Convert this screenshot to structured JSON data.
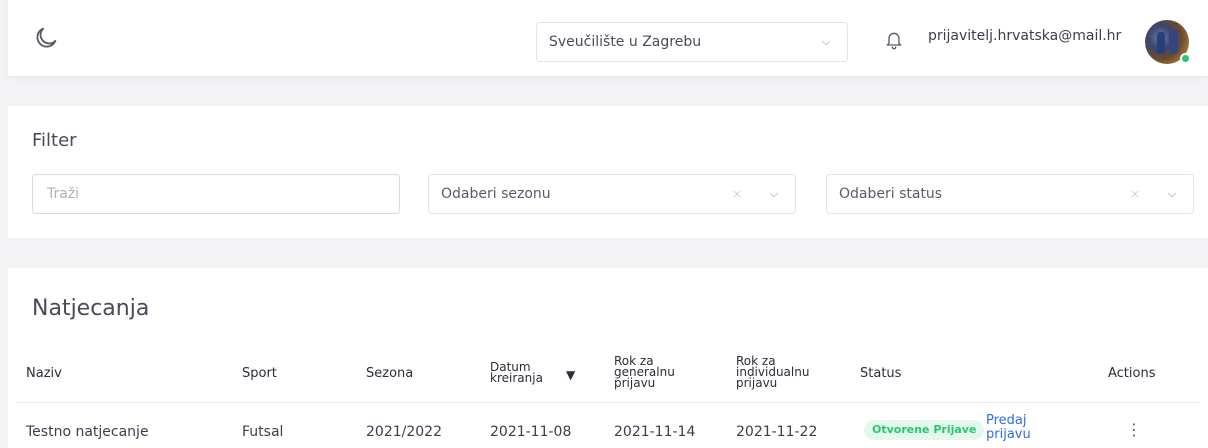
{
  "header": {
    "university_select": {
      "value": "Sveučilište u Zagrebu"
    },
    "user_email": "prijavitelj.hrvatska@mail.hr"
  },
  "filter": {
    "title": "Filter",
    "search_placeholder": "Traži",
    "season_placeholder": "Odaberi sezonu",
    "status_placeholder": "Odaberi status"
  },
  "competitions": {
    "title": "Natjecanja",
    "columns": {
      "name": "Naziv",
      "sport": "Sport",
      "season": "Sezona",
      "created": [
        "Datum",
        "kreiranja"
      ],
      "general_deadline": [
        "Rok za",
        "generalnu",
        "prijavu"
      ],
      "individual_deadline": [
        "Rok za",
        "individualnu",
        "prijavu"
      ],
      "status": "Status",
      "actions": "Actions"
    },
    "sort_indicator": "▼",
    "rows": [
      {
        "name": "Testno natjecanje",
        "sport": "Futsal",
        "season": "2021/2022",
        "created": "2021-11-08",
        "general_deadline": "2021-11-14",
        "individual_deadline": "2021-11-22",
        "status": "Otvorene Prijave",
        "action_link": [
          "Predaj",
          "prijavu"
        ],
        "actions_menu": "⋮"
      }
    ]
  },
  "colors": {
    "status_green": "#28c76f",
    "status_green_bg": "#e5f8ed",
    "link_blue": "#2e6be6",
    "page_bg": "#f3f3f5"
  },
  "icons": {
    "theme_toggle": "moon-icon",
    "notifications": "bell-icon",
    "dropdown": "chevron-down-icon",
    "clear": "close-icon",
    "row_actions": "more-vertical-icon"
  }
}
